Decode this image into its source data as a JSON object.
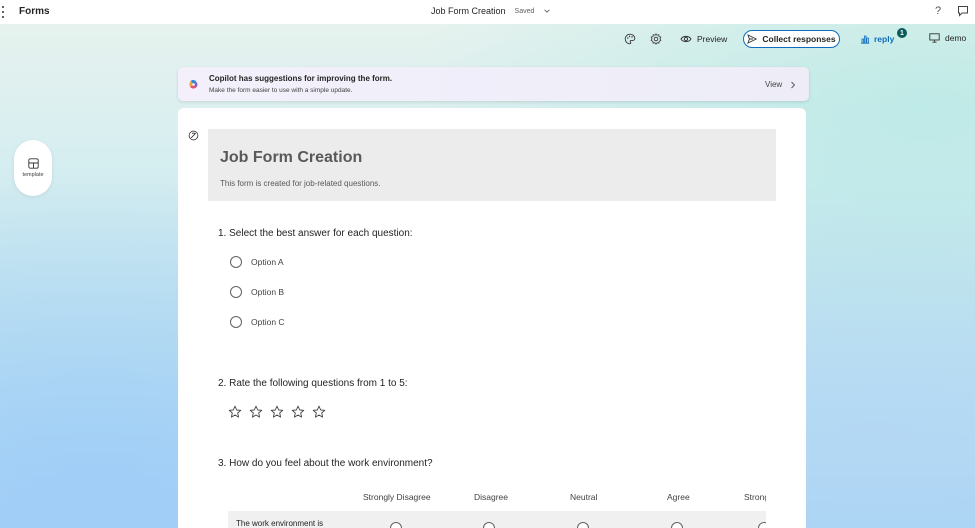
{
  "app": {
    "name": "Forms",
    "document_title": "Job Form Creation",
    "save_status": "Saved"
  },
  "toolbar": {
    "preview_label": "Preview",
    "collect_label": "Collect responses",
    "reply_label": "reply",
    "reply_count": "1",
    "demo_label": "demo"
  },
  "copilot": {
    "title": "Copilot has suggestions for improving the form.",
    "subtitle": "Make the form easier to use with a simple update.",
    "view_label": "View"
  },
  "side": {
    "template_label": "template"
  },
  "form": {
    "title": "Job Form Creation",
    "description": "This form is created for job-related questions.",
    "questions": [
      {
        "text": "1. Select the best answer for each question:",
        "options": [
          "Option A",
          "Option B",
          "Option C"
        ]
      },
      {
        "text": "2. Rate the following questions from 1 to 5:",
        "rating_max": 5
      },
      {
        "text": "3. How do you feel about the work environment?",
        "scale": [
          "Strongly Disagree",
          "Disagree",
          "Neutral",
          "Agree",
          "Strongly Agree"
        ],
        "statements": [
          "The work environment is"
        ]
      }
    ]
  },
  "colors": {
    "accent": "#0f6cbd",
    "badge": "#0b5a5a",
    "header_bg": "#ececec"
  }
}
